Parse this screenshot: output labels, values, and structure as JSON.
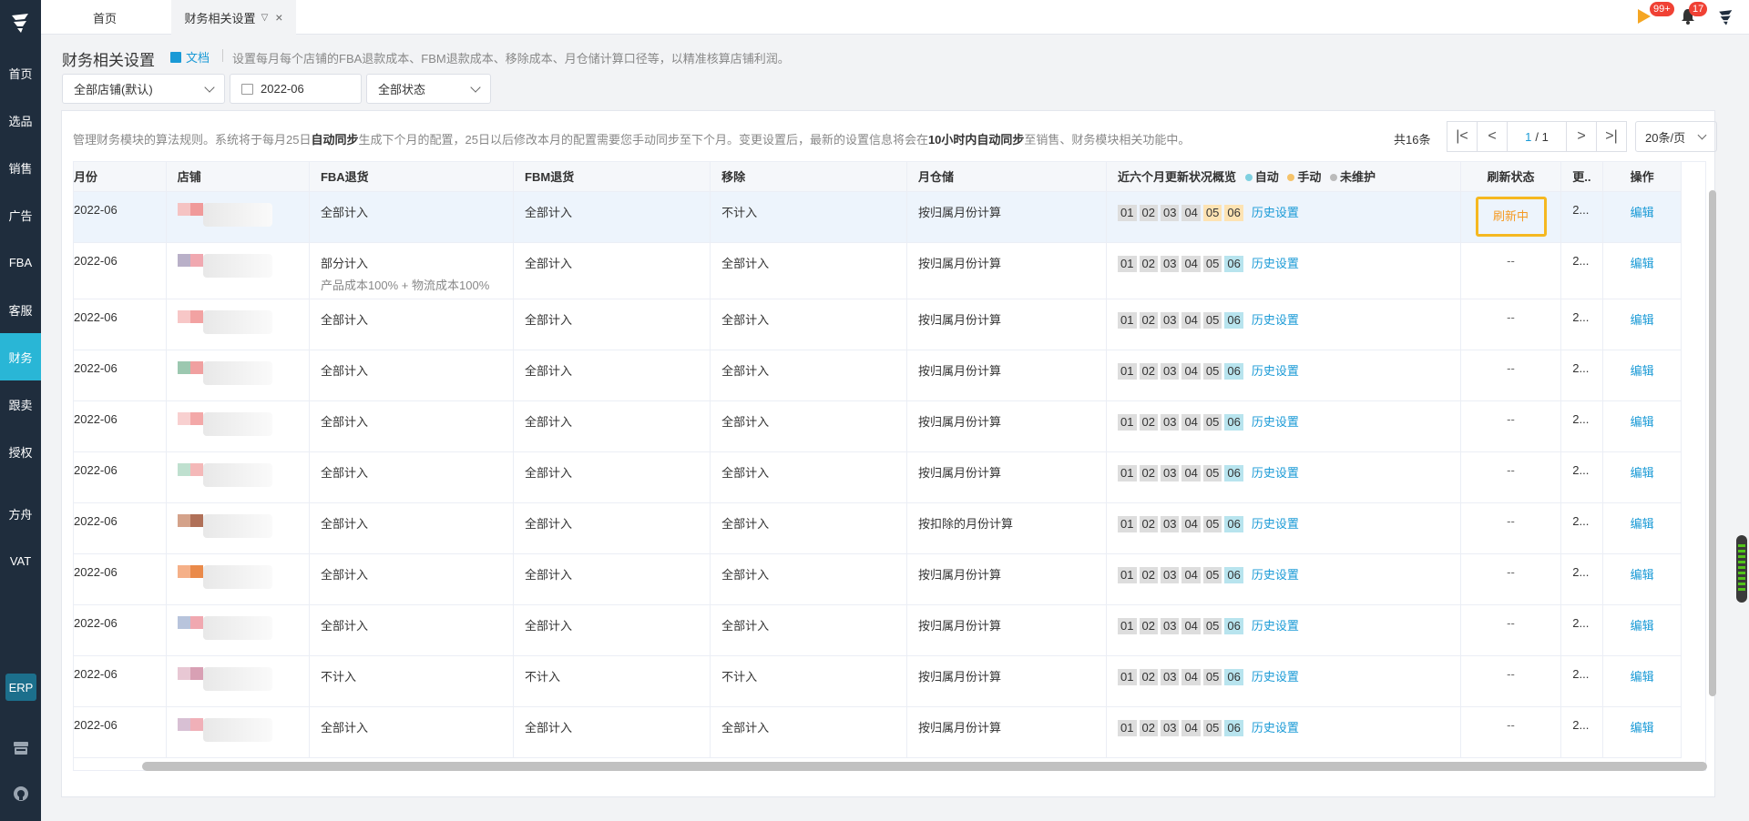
{
  "sidebar": {
    "items": [
      {
        "label": "首页"
      },
      {
        "label": "选品"
      },
      {
        "label": "销售"
      },
      {
        "label": "广告"
      },
      {
        "label": "FBA"
      },
      {
        "label": "客服"
      },
      {
        "label": "财务"
      },
      {
        "label": "跟卖"
      },
      {
        "label": "授权"
      },
      {
        "label": "方舟"
      },
      {
        "label": "VAT"
      }
    ],
    "erp_label": "ERP",
    "active": "财务"
  },
  "tabs": {
    "home": "首页",
    "current": "财务相关设置"
  },
  "topright": {
    "flag_badge": "99+",
    "bell_badge": "17"
  },
  "header": {
    "title": "财务相关设置",
    "doc_link": "文档",
    "description": "设置每月每个店铺的FBA退款成本、FBM退款成本、移除成本、月仓储计算口径等，以精准核算店铺利润。"
  },
  "filters": {
    "shop": "全部店铺(默认)",
    "month": "2022-06",
    "status": "全部状态"
  },
  "notice": {
    "p1": "管理财务模块的算法规则。系统将于每月25日",
    "b1": "自动同步",
    "p2": "生成下个月的配置，25日以后修改本月的配置需要您手动同步至下个月。变更设置后，最新的设置信息将会在",
    "b2": "10小时内自动同步",
    "p3": "至销售、财务模块相关功能中。"
  },
  "pagination": {
    "total": "共16条",
    "current": "1",
    "pages": "/ 1",
    "page_size": "20条/页"
  },
  "table": {
    "headers": {
      "month": "月份",
      "shop": "店铺",
      "fba": "FBA退货",
      "fbm": "FBM退货",
      "removal": "移除",
      "storage": "月仓储",
      "overview": "近六个月更新状况概览",
      "legend_auto": "自动",
      "legend_manual": "手动",
      "legend_none": "未维护",
      "refresh": "刷新状态",
      "updated": "更..",
      "action": "操作"
    },
    "legend_colors": {
      "auto": "#7fd0e0",
      "manual": "#f5c36a",
      "none": "#bbbbbb"
    },
    "months": [
      "01",
      "02",
      "03",
      "04",
      "05",
      "06"
    ],
    "history_label": "历史设置",
    "edit_label": "编辑",
    "rows": [
      {
        "month": "2022-06",
        "fba": "全部计入",
        "fba_sub": "",
        "fbm": "全部计入",
        "removal": "不计入",
        "storage": "按归属月份计算",
        "status": [
          "n",
          "n",
          "n",
          "n",
          "m",
          "m"
        ],
        "refresh": "刷新中",
        "updated": "2...",
        "shop_colors": [
          "#f5c3c3",
          "#f09a9a"
        ]
      },
      {
        "month": "2022-06",
        "fba": "部分计入",
        "fba_sub": "产品成本100% + 物流成本100%",
        "fbm": "全部计入",
        "removal": "全部计入",
        "storage": "按归属月份计算",
        "status": [
          "n",
          "n",
          "n",
          "n",
          "n",
          "a"
        ],
        "refresh": "--",
        "updated": "2...",
        "shop_colors": [
          "#b9b0c8",
          "#f0a8b0"
        ]
      },
      {
        "month": "2022-06",
        "fba": "全部计入",
        "fba_sub": "",
        "fbm": "全部计入",
        "removal": "全部计入",
        "storage": "按归属月份计算",
        "status": [
          "n",
          "n",
          "n",
          "n",
          "n",
          "a"
        ],
        "refresh": "--",
        "updated": "2...",
        "shop_colors": [
          "#f7c7c7",
          "#f2a2a2"
        ]
      },
      {
        "month": "2022-06",
        "fba": "全部计入",
        "fba_sub": "",
        "fbm": "全部计入",
        "removal": "全部计入",
        "storage": "按归属月份计算",
        "status": [
          "n",
          "n",
          "n",
          "n",
          "n",
          "a"
        ],
        "refresh": "--",
        "updated": "2...",
        "shop_colors": [
          "#9cc8b0",
          "#f0a0a0"
        ]
      },
      {
        "month": "2022-06",
        "fba": "全部计入",
        "fba_sub": "",
        "fbm": "全部计入",
        "removal": "全部计入",
        "storage": "按归属月份计算",
        "status": [
          "n",
          "n",
          "n",
          "n",
          "n",
          "a"
        ],
        "refresh": "--",
        "updated": "2...",
        "shop_colors": [
          "#f8d0d0",
          "#f3a8a8"
        ]
      },
      {
        "month": "2022-06",
        "fba": "全部计入",
        "fba_sub": "",
        "fbm": "全部计入",
        "removal": "全部计入",
        "storage": "按归属月份计算",
        "status": [
          "n",
          "n",
          "n",
          "n",
          "n",
          "a"
        ],
        "refresh": "--",
        "updated": "2...",
        "shop_colors": [
          "#bfe0cf",
          "#f4b8b8"
        ]
      },
      {
        "month": "2022-06",
        "fba": "全部计入",
        "fba_sub": "",
        "fbm": "全部计入",
        "removal": "全部计入",
        "storage": "按扣除的月份计算",
        "status": [
          "n",
          "n",
          "n",
          "n",
          "n",
          "a"
        ],
        "refresh": "--",
        "updated": "2...",
        "shop_colors": [
          "#d4a28a",
          "#b07058"
        ]
      },
      {
        "month": "2022-06",
        "fba": "全部计入",
        "fba_sub": "",
        "fbm": "全部计入",
        "removal": "全部计入",
        "storage": "按归属月份计算",
        "status": [
          "n",
          "n",
          "n",
          "n",
          "n",
          "a"
        ],
        "refresh": "--",
        "updated": "2...",
        "shop_colors": [
          "#f5b088",
          "#ea8a4a"
        ]
      },
      {
        "month": "2022-06",
        "fba": "全部计入",
        "fba_sub": "",
        "fbm": "全部计入",
        "removal": "全部计入",
        "storage": "按归属月份计算",
        "status": [
          "n",
          "n",
          "n",
          "n",
          "n",
          "a"
        ],
        "refresh": "--",
        "updated": "2...",
        "shop_colors": [
          "#b8c4dc",
          "#f0a8b0"
        ]
      },
      {
        "month": "2022-06",
        "fba": "不计入",
        "fba_sub": "",
        "fbm": "不计入",
        "removal": "不计入",
        "storage": "按归属月份计算",
        "status": [
          "n",
          "n",
          "n",
          "n",
          "n",
          "a"
        ],
        "refresh": "--",
        "updated": "2...",
        "shop_colors": [
          "#e8c8d4",
          "#d8a0b4"
        ]
      },
      {
        "month": "2022-06",
        "fba": "全部计入",
        "fba_sub": "",
        "fbm": "全部计入",
        "removal": "全部计入",
        "storage": "按归属月份计算",
        "status": [
          "n",
          "n",
          "n",
          "n",
          "n",
          "a"
        ],
        "refresh": "--",
        "updated": "2...",
        "shop_colors": [
          "#d8c0d4",
          "#f0b0b8"
        ]
      }
    ]
  }
}
